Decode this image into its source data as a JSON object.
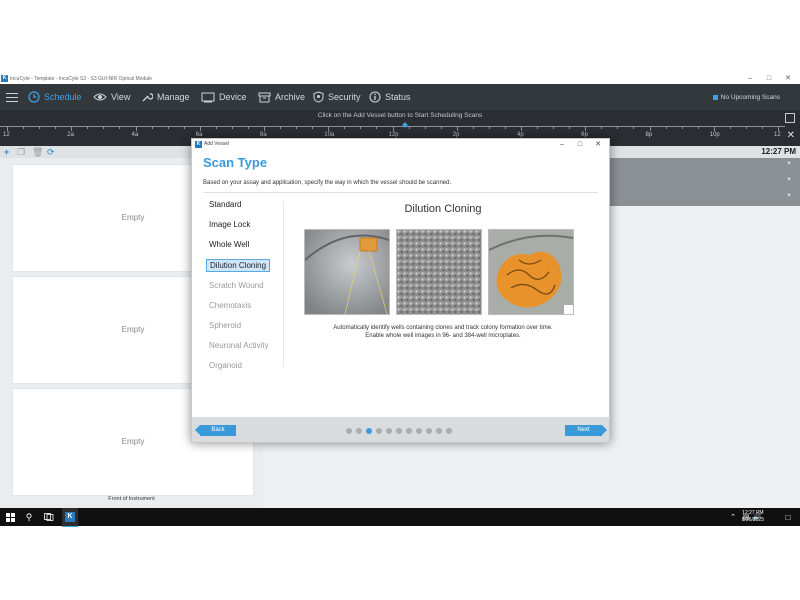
{
  "window": {
    "title": "IncuCyte - Template - IncuCyte S3 - S3 GUI-NIR Optical Module",
    "app_icon_letter": "K"
  },
  "nav": {
    "items": [
      {
        "label": "Schedule",
        "icon": "clock-icon",
        "active": true
      },
      {
        "label": "View",
        "icon": "eye-icon",
        "active": false
      },
      {
        "label": "Manage",
        "icon": "wrench-icon",
        "active": false
      },
      {
        "label": "Device",
        "icon": "device-icon",
        "active": false
      },
      {
        "label": "Archive",
        "icon": "archive-icon",
        "active": false
      },
      {
        "label": "Security",
        "icon": "shield-icon",
        "active": false
      },
      {
        "label": "Status",
        "icon": "info-icon",
        "active": false
      }
    ],
    "upcoming_label": "No Upcoming Scans"
  },
  "timeline": {
    "message": "Click on the Add Vessel button to Start Scheduling Scans",
    "ticks": [
      "12",
      "2a",
      "4a",
      "6a",
      "8a",
      "10a",
      "12p",
      "2p",
      "4p",
      "6p",
      "8p",
      "10p",
      "12"
    ]
  },
  "toolbar": {
    "time": "12:27 PM"
  },
  "left_panel": {
    "trays": [
      "Empty",
      "Empty",
      "Empty"
    ],
    "footer_label": "Front of Instrument"
  },
  "dialog": {
    "window_title": "Add Vessel",
    "title": "Scan Type",
    "description": "Based on your assay and application, specify the way in which the vessel should be scanned.",
    "options": [
      {
        "label": "Standard",
        "state": "enabled"
      },
      {
        "label": "Image Lock",
        "state": "enabled"
      },
      {
        "label": "Whole Well",
        "state": "enabled"
      },
      {
        "label": "Dilution Cloning",
        "state": "selected"
      },
      {
        "label": "Scratch Wound",
        "state": "disabled"
      },
      {
        "label": "Chemotaxis",
        "state": "disabled"
      },
      {
        "label": "Spheroid",
        "state": "disabled"
      },
      {
        "label": "Neuronal Activity",
        "state": "disabled"
      },
      {
        "label": "Organoid",
        "state": "disabled"
      }
    ],
    "detail": {
      "title": "Dilution Cloning",
      "description_line1": "Automatically identify wells containing clones and track colony formation over time.",
      "description_line2": "Enable whole well images in 96- and 384-well microplates."
    },
    "back_label": "Back",
    "next_label": "Next",
    "steps_total": 11,
    "step_active_index": 2
  },
  "taskbar": {
    "time": "12:27 PM",
    "date": "8/26/2025"
  },
  "colors": {
    "accent": "#3a9ad9",
    "nav_bg": "#33383d",
    "timeline_bg": "#2a2e33"
  }
}
